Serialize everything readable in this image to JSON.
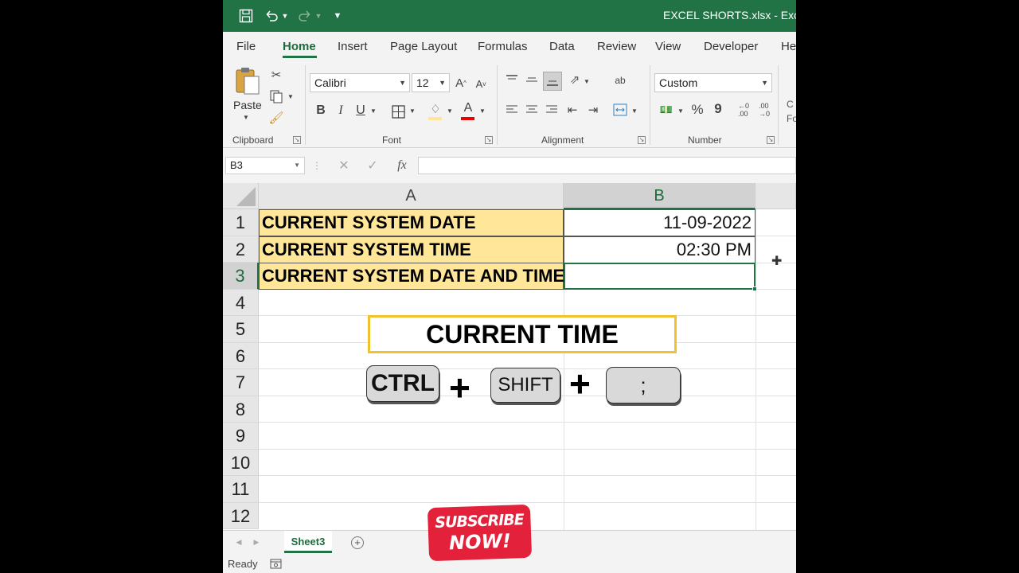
{
  "window": {
    "title": "EXCEL SHORTS.xlsx  -  Excel"
  },
  "ribbon_tabs": [
    "File",
    "Home",
    "Insert",
    "Page Layout",
    "Formulas",
    "Data",
    "Review",
    "View",
    "Developer",
    "Help"
  ],
  "ribbon": {
    "clipboard": {
      "paste_label": "Paste",
      "group_label": "Clipboard"
    },
    "font": {
      "font_name": "Calibri",
      "font_size": "12",
      "bold": "B",
      "italic": "I",
      "underline": "U",
      "group_label": "Font"
    },
    "alignment": {
      "group_label": "Alignment"
    },
    "number": {
      "format": "Custom",
      "percent": "%",
      "comma": "9",
      "group_label": "Number"
    },
    "styles_partial": "C\nFo"
  },
  "formula_bar": {
    "name_box": "B3",
    "fx": "fx",
    "formula": ""
  },
  "grid": {
    "columns": [
      "A",
      "B"
    ],
    "selected_column": "B",
    "rows": [
      "1",
      "2",
      "3",
      "4",
      "5",
      "6",
      "7",
      "8",
      "9",
      "10",
      "11",
      "12"
    ],
    "selected_row": "3",
    "cells": [
      {
        "a": "CURRENT SYSTEM DATE",
        "b": "11-09-2022"
      },
      {
        "a": "CURRENT SYSTEM TIME",
        "b": "02:30 PM"
      },
      {
        "a": "CURRENT SYSTEM DATE AND TIME",
        "b": ""
      }
    ],
    "fill_color": "#ffe699"
  },
  "overlay": {
    "title": "CURRENT TIME",
    "keys": [
      "CTRL",
      "SHIFT",
      ";"
    ],
    "plus": "+"
  },
  "sheet_tabs": {
    "active": "Sheet3",
    "add": "+"
  },
  "status": "Ready",
  "subscribe": {
    "line1": "SUBSCRIBE",
    "line2": "NOW!"
  },
  "colors": {
    "excel_green": "#217346",
    "cell_fill": "#ffe699",
    "highlight_border": "#f2c12e",
    "subscribe_red": "#e4213a"
  }
}
